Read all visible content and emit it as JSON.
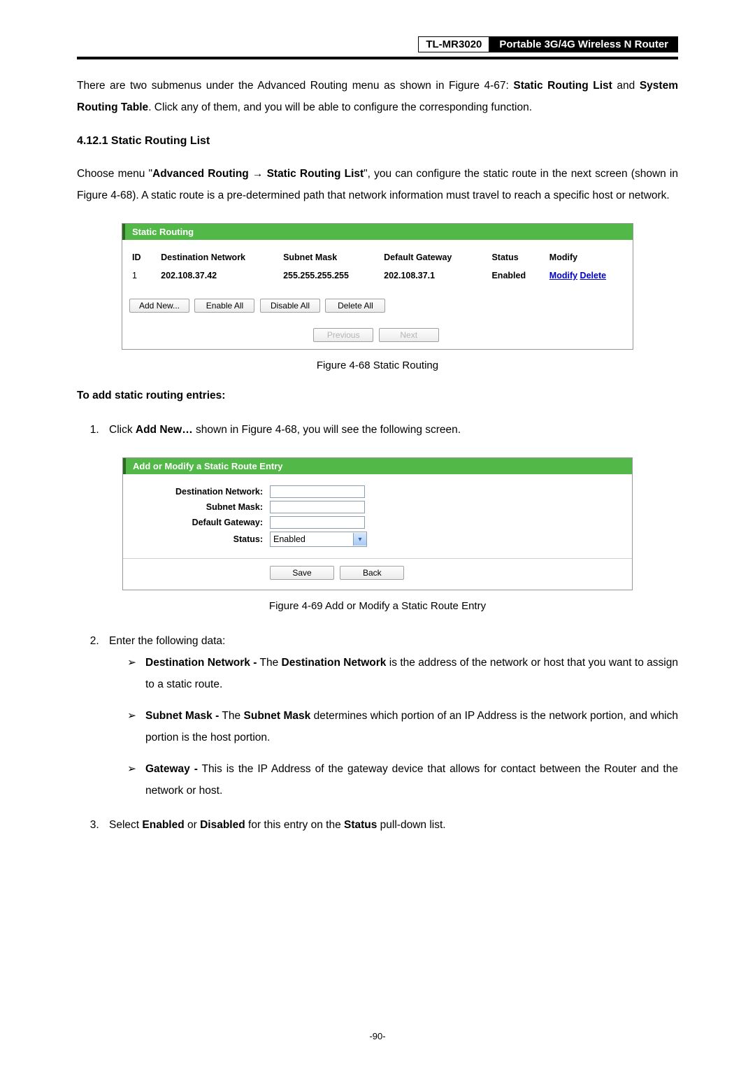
{
  "header": {
    "model": "TL-MR3020",
    "product": "Portable 3G/4G Wireless N Router"
  },
  "intro": {
    "prefix": "There are two submenus under the Advanced Routing menu as shown in Figure 4-67: ",
    "b1": "Static Routing List",
    "mid": " and ",
    "b2": "System Routing Table",
    "suffix": ". Click any of them, and you will be able to configure the corresponding function."
  },
  "section_title": "4.12.1  Static Routing List",
  "para2": {
    "t1": "Choose menu \"",
    "b1": "Advanced Routing",
    "arrow": " → ",
    "b2": "Static Routing List",
    "t2": "\", you can configure the static route in the next screen (shown in Figure 4-68). A static route is a pre-determined path that network information must travel to reach a specific host or network."
  },
  "panel1": {
    "title": "Static Routing",
    "headers": {
      "id": "ID",
      "dn": "Destination Network",
      "sm": "Subnet Mask",
      "gw": "Default Gateway",
      "st": "Status",
      "md": "Modify"
    },
    "row": {
      "id": "1",
      "dn": "202.108.37.42",
      "sm": "255.255.255.255",
      "gw": "202.108.37.1",
      "st": "Enabled",
      "modify": "Modify",
      "delete": "Delete"
    },
    "buttons": {
      "addnew": "Add New...",
      "enableall": "Enable All",
      "disableall": "Disable All",
      "deleteall": "Delete All",
      "previous": "Previous",
      "next": "Next"
    }
  },
  "figcap1": "Figure 4-68    Static Routing",
  "subhead": "To add static routing entries:",
  "step1": {
    "prefix": "Click ",
    "bold": "Add New…",
    "suffix": " shown in Figure 4-68, you will see the following screen."
  },
  "panel2": {
    "title": "Add or Modify a Static Route Entry",
    "labels": {
      "dn": "Destination Network:",
      "sm": "Subnet Mask:",
      "gw": "Default Gateway:",
      "st": "Status:"
    },
    "status_value": "Enabled",
    "buttons": {
      "save": "Save",
      "back": "Back"
    }
  },
  "figcap2": "Figure 4-69    Add or Modify a Static Route Entry",
  "step2_intro": "Enter the following data:",
  "bul1": {
    "b1": "Destination Network -",
    "t1": " The ",
    "b2": "Destination Network",
    "t2": " is the address of the network or host that you want to assign to a static route."
  },
  "bul2": {
    "b1": "Subnet Mask -",
    "t1": " The ",
    "b2": "Subnet Mask",
    "t2": " determines which portion of an IP Address is the network portion, and which portion is the host portion."
  },
  "bul3": {
    "b1": "Gateway -",
    "t1": " This is the IP Address of the gateway device that allows for contact between the Router and the network or host."
  },
  "step3": {
    "t1": "Select ",
    "b1": "Enabled",
    "t2": " or ",
    "b2": "Disabled",
    "t3": " for this entry on the ",
    "b3": "Status",
    "t4": " pull-down list."
  },
  "pageno": "-90-"
}
